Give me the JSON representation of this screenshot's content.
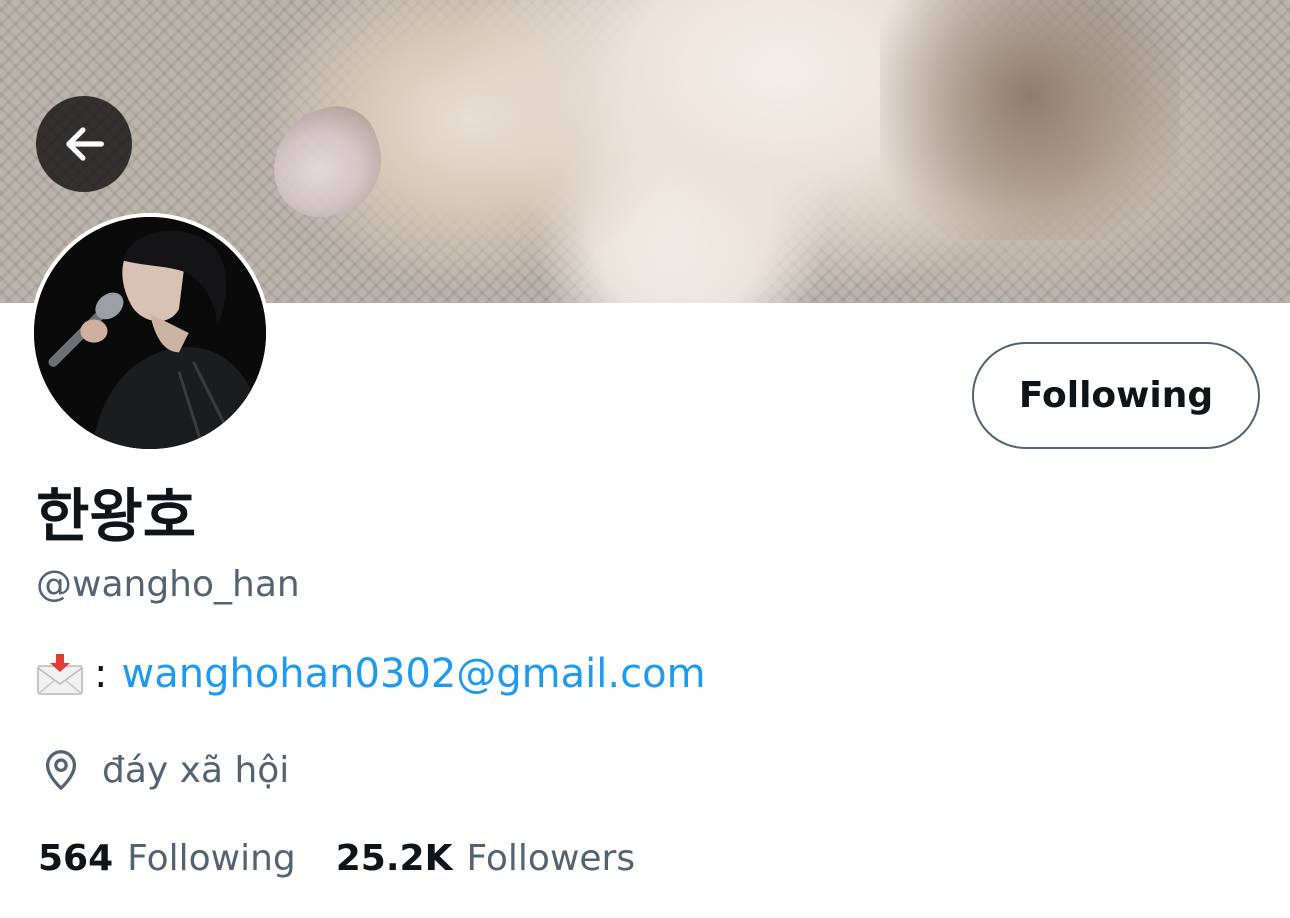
{
  "header": {
    "back_icon": "arrow-left-icon"
  },
  "profile": {
    "display_name": "한왕호",
    "handle": "@wangho_han",
    "follow_button_label": "Following",
    "bio": {
      "icon": "incoming-envelope-icon",
      "separator": ":",
      "email": "wanghohan0302@gmail.com"
    },
    "location": {
      "icon": "location-pin-icon",
      "text": "đáy xã hội"
    },
    "stats": {
      "following_count": "564",
      "following_label": "Following",
      "followers_count": "25.2K",
      "followers_label": "Followers"
    }
  },
  "colors": {
    "link": "#1d9bf0",
    "secondary_text": "#536471",
    "primary_text": "#0f1419"
  }
}
